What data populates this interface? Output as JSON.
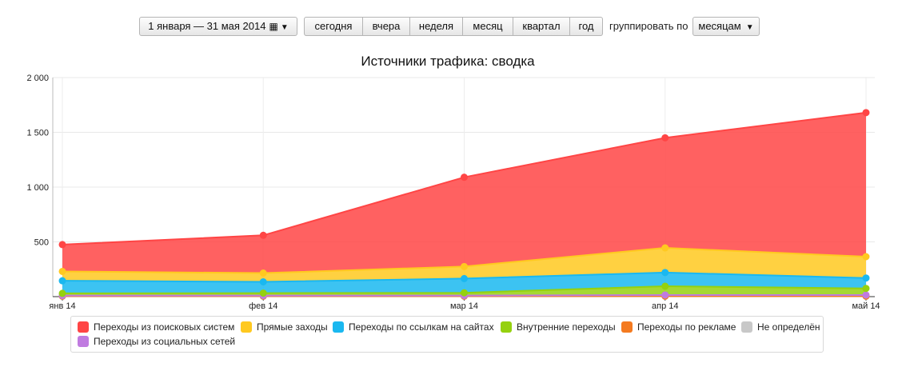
{
  "toolbar": {
    "date_range": "1 января — 31 мая 2014",
    "calendar_icon": "calendar-grid-icon",
    "periods": [
      "сегодня",
      "вчера",
      "неделя",
      "месяц",
      "квартал",
      "год"
    ],
    "group_label": "группировать по",
    "group_value": "месяцам"
  },
  "chart_data": {
    "type": "area",
    "stacked": true,
    "title": "Источники трафика: сводка",
    "xlabel": "",
    "ylabel": "",
    "categories": [
      "янв 14",
      "фев 14",
      "мар 14",
      "апр 14",
      "май 14"
    ],
    "ylim": [
      0,
      2000
    ],
    "yticks": [
      0,
      500,
      1000,
      1500,
      2000
    ],
    "ytick_labels": [
      "",
      "500",
      "1 000",
      "1 500",
      "2 000"
    ],
    "grid": true,
    "legend_position": "bottom",
    "series": [
      {
        "name": "Не определён",
        "color": "#c8c8c8",
        "values": [
          3,
          3,
          3,
          3,
          3
        ]
      },
      {
        "name": "Переходы по рекламе",
        "color": "#f47a20",
        "values": [
          2,
          2,
          2,
          2,
          2
        ]
      },
      {
        "name": "Переходы из социальных сетей",
        "color": "#c07be0",
        "values": [
          5,
          5,
          5,
          10,
          10
        ]
      },
      {
        "name": "Внутренние переходы",
        "color": "#95d10f",
        "values": [
          20,
          22,
          25,
          80,
          60
        ]
      },
      {
        "name": "Переходы по ссылкам на сайтах",
        "color": "#1ab8f0",
        "values": [
          115,
          103,
          130,
          125,
          95
        ]
      },
      {
        "name": "Прямые заходы",
        "color": "#ffc920",
        "values": [
          85,
          80,
          110,
          225,
          195
        ]
      },
      {
        "name": "Переходы из поисковых систем",
        "color": "#ff4545",
        "values": [
          245,
          345,
          815,
          1005,
          1315
        ]
      }
    ]
  },
  "legend": [
    {
      "label": "Переходы из поисковых систем",
      "color": "#ff4545"
    },
    {
      "label": "Прямые заходы",
      "color": "#ffc920"
    },
    {
      "label": "Переходы по ссылкам на сайтах",
      "color": "#1ab8f0"
    },
    {
      "label": "Внутренние переходы",
      "color": "#95d10f"
    },
    {
      "label": "Переходы по рекламе",
      "color": "#f47a20"
    },
    {
      "label": "Не определён",
      "color": "#c8c8c8"
    },
    {
      "label": "Переходы из социальных сетей",
      "color": "#c07be0"
    }
  ]
}
